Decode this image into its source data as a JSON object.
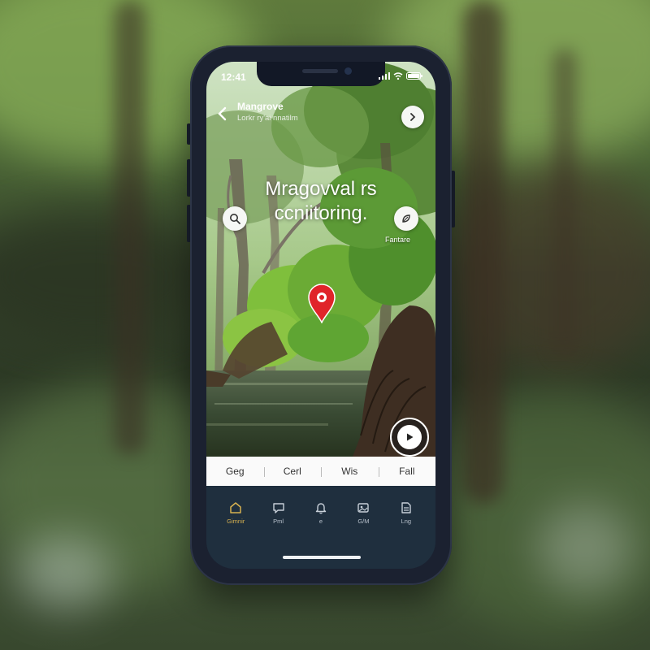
{
  "status_bar": {
    "time": "12:41"
  },
  "header": {
    "title": "Mangrove",
    "subtitle": "Lorkr ry'ai nnatilm",
    "back_icon": "chevron-left-icon",
    "forward_icon": "chevron-right-icon"
  },
  "hero": {
    "line1": "Mragovval rs",
    "line2": "ccniitoring."
  },
  "side_actions": {
    "search_icon": "search-icon",
    "feature_icon": "leaf-icon",
    "feature_label": "Fantare"
  },
  "map_pin_icon": "map-pin-icon",
  "play_icon": "play-icon",
  "filter_bar": {
    "items": [
      "Geg",
      "Cerl",
      "Wis",
      "Fall"
    ]
  },
  "tab_bar": {
    "tabs": [
      {
        "label": "Gimnir",
        "icon": "home-icon",
        "active": true
      },
      {
        "label": "Pml",
        "icon": "chat-icon",
        "active": false
      },
      {
        "label": "e",
        "icon": "bell-icon",
        "active": false
      },
      {
        "label": "G/M",
        "icon": "gallery-icon",
        "active": false
      },
      {
        "label": "Lng",
        "icon": "document-icon",
        "active": false
      }
    ]
  },
  "colors": {
    "accent": "#d6b150",
    "pin": "#e0242a",
    "tabbar_bg": "#1f2f3e",
    "frame": "#1b2130"
  }
}
